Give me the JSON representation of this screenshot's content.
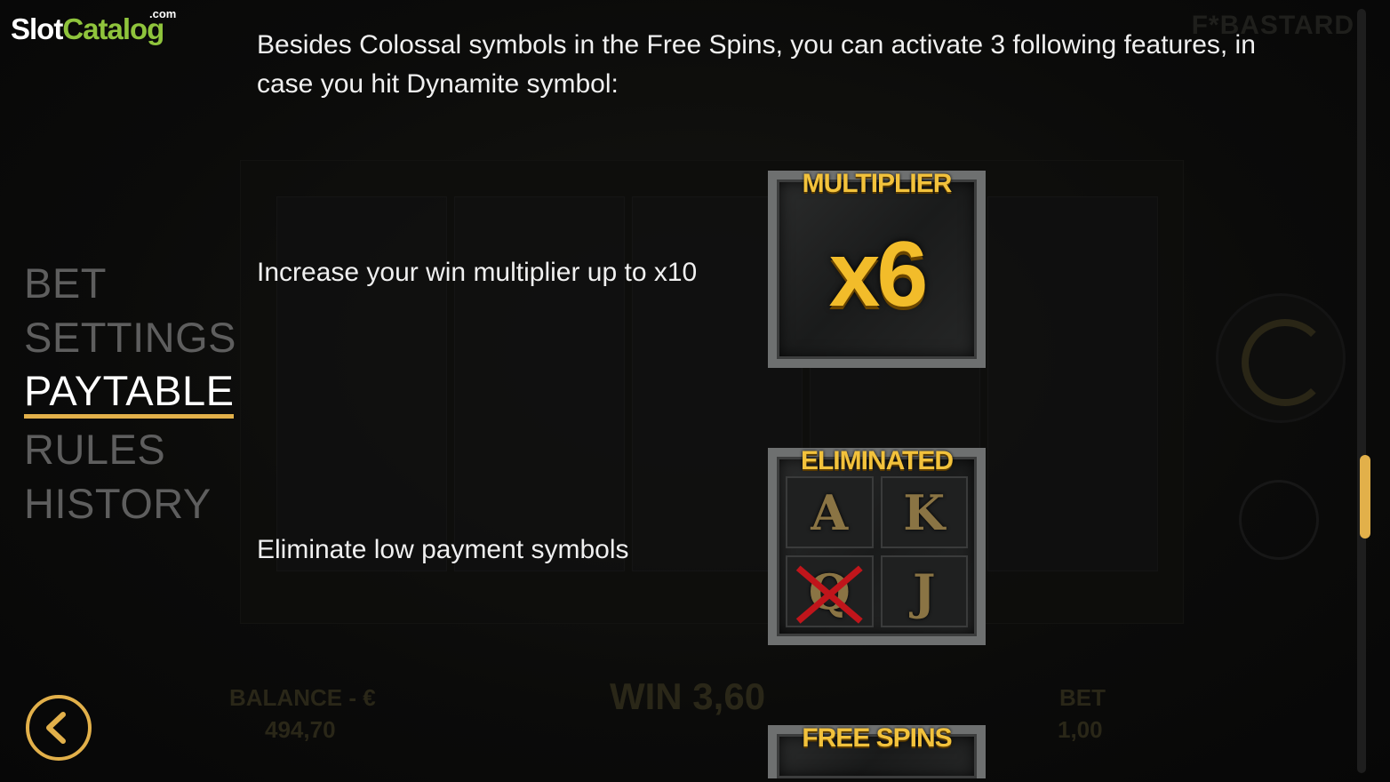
{
  "logo": {
    "part1": "Slot",
    "part2": "Catalog",
    "suffix": ".com"
  },
  "background": {
    "brand": "F*BASTARD",
    "balance_label": "BALANCE - €",
    "balance_value": "494,70",
    "win_label": "WIN 3,60",
    "bet_label": "BET",
    "bet_value": "1,00"
  },
  "menu": {
    "items": [
      "BET",
      "SETTINGS",
      "PAYTABLE",
      "RULES",
      "HISTORY"
    ],
    "active": "PAYTABLE"
  },
  "content": {
    "intro": "Besides Colossal symbols in the Free Spins, you can activate 3 following features, in case you hit Dynamite symbol:",
    "features": [
      {
        "text": "Increase your win multiplier up to x10",
        "symbol_label": "MULTIPLIER",
        "symbol_value": "x6"
      },
      {
        "text": "Eliminate low payment symbols",
        "symbol_label": "ELIMINATED",
        "symbol_cells": [
          "A",
          "K",
          "Q",
          "J"
        ]
      },
      {
        "text": "",
        "symbol_label": "FREE SPINS"
      }
    ]
  },
  "colors": {
    "accent": "#e2b04a",
    "menu_inactive": "#5e5e5e",
    "logo_green": "#8fc43c",
    "symbol_gold": "#f2c23c"
  },
  "icons": {
    "back": "chevron-left-icon",
    "spin": "refresh-icon",
    "coins": "coins-icon"
  }
}
